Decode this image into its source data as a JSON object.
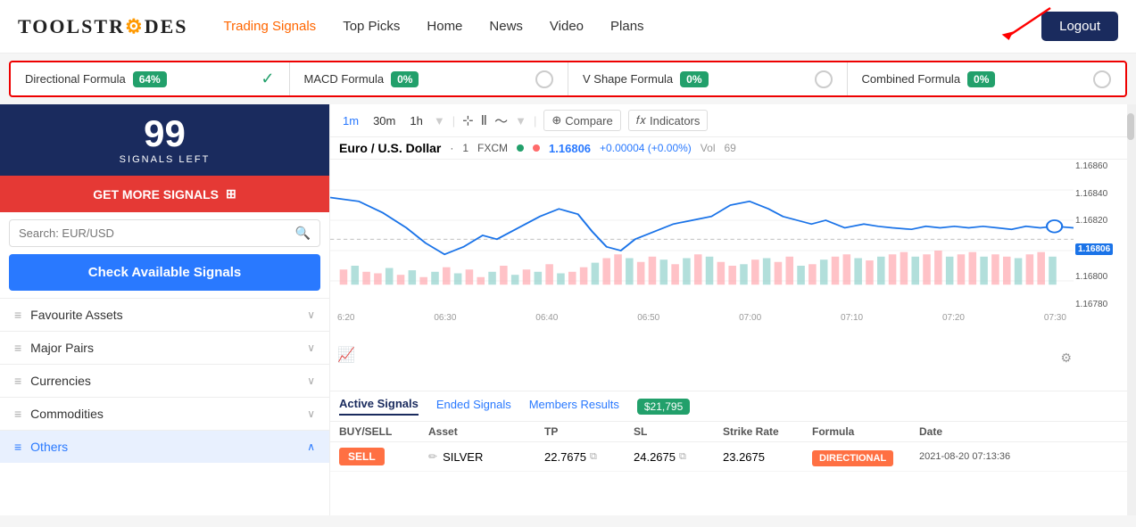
{
  "header": {
    "logo_text": "TOOLSTR",
    "logo_accent": "A",
    "logo_rest": "DES",
    "nav": [
      {
        "label": "Trading Signals",
        "active": true
      },
      {
        "label": "Top Picks",
        "active": false
      },
      {
        "label": "Home",
        "active": false
      },
      {
        "label": "News",
        "active": false
      },
      {
        "label": "Video",
        "active": false
      },
      {
        "label": "Plans",
        "active": false
      }
    ],
    "logout_label": "Logout"
  },
  "formula_bar": {
    "items": [
      {
        "label": "Directional Formula",
        "badge": "64%",
        "icon": "check"
      },
      {
        "label": "MACD Formula",
        "badge": "0%",
        "icon": "circle"
      },
      {
        "label": "V Shape Formula",
        "badge": "0%",
        "icon": "circle"
      },
      {
        "label": "Combined Formula",
        "badge": "0%",
        "icon": "circle"
      }
    ]
  },
  "sidebar": {
    "signals_count": "99",
    "signals_left_label": "SIGNALS LEFT",
    "get_more_label": "GET MORE SIGNALS",
    "search_placeholder": "Search: EUR/USD",
    "check_signals_label": "Check Available Signals",
    "menu_items": [
      {
        "label": "Favourite Assets",
        "expanded": false
      },
      {
        "label": "Major Pairs",
        "expanded": false
      },
      {
        "label": "Currencies",
        "expanded": false
      },
      {
        "label": "Commodities",
        "expanded": false
      },
      {
        "label": "Others",
        "expanded": true,
        "active": true
      }
    ]
  },
  "chart": {
    "timeframes": [
      {
        "label": "1m",
        "active": true
      },
      {
        "label": "30m",
        "active": false
      },
      {
        "label": "1h",
        "active": false
      }
    ],
    "compare_label": "Compare",
    "indicators_label": "Indicators",
    "pair": "Euro / U.S. Dollar",
    "multiplier": "1",
    "exchange": "FXCM",
    "price": "1.16806",
    "change": "+0.00004 (+0.00%)",
    "vol": "69",
    "price_label": "1.16806",
    "x_labels": [
      "6:20",
      "06:30",
      "06:40",
      "06:50",
      "07:00",
      "07:10",
      "07:20",
      "07:30"
    ],
    "y_labels": [
      "1.16860",
      "1.16840",
      "1.16820",
      "1.16806",
      "1.16800",
      "1.16780"
    ]
  },
  "signals_table": {
    "tabs": [
      {
        "label": "Active Signals",
        "active": true
      },
      {
        "label": "Ended Signals",
        "active": false
      },
      {
        "label": "Members Results",
        "active": false
      }
    ],
    "members_badge": "$21,795",
    "columns": [
      "BUY/SELL",
      "Asset",
      "TP",
      "SL",
      "Strike Rate",
      "Formula",
      "Date"
    ],
    "rows": [
      {
        "type": "SELL",
        "asset": "SILVER",
        "tp": "22.7675",
        "sl": "24.2675",
        "strike_rate": "23.2675",
        "formula": "DIRECTIONAL",
        "date": "2021-08-20 07:13:36"
      }
    ]
  }
}
